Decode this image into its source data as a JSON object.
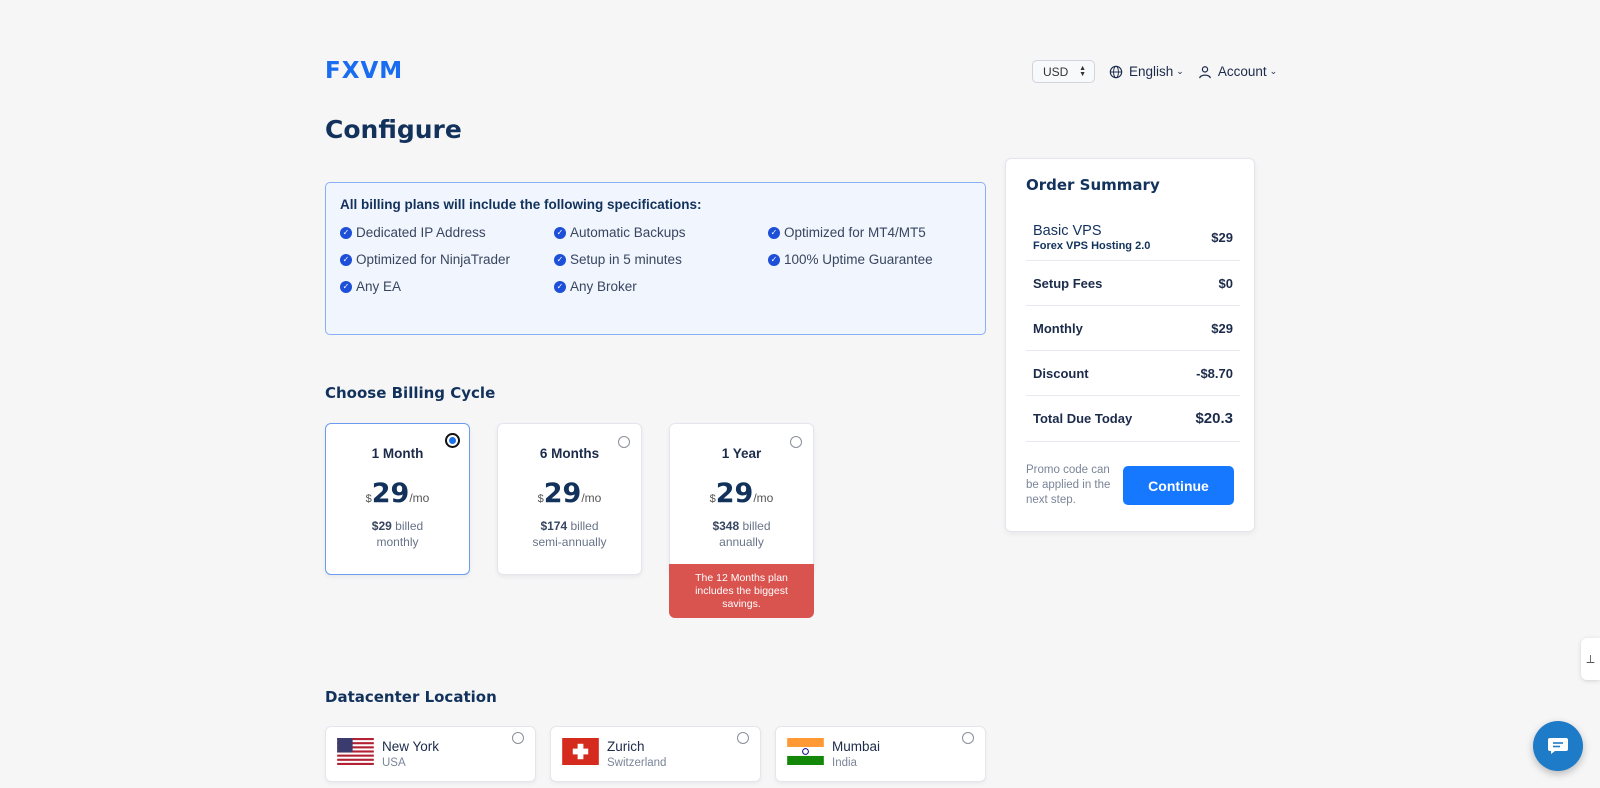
{
  "brand": {
    "logo_text": "FXVM"
  },
  "topnav": {
    "currency": "USD",
    "language": "English",
    "account": "Account"
  },
  "page": {
    "title": "Configure"
  },
  "specs": {
    "heading": "All billing plans will include the following specifications:",
    "items": [
      "Dedicated IP Address",
      "Automatic Backups",
      "Optimized for MT4/MT5",
      "Optimized for NinjaTrader",
      "Setup in 5 minutes",
      "100% Uptime Guarantee",
      "Any EA",
      "Any Broker"
    ]
  },
  "billing": {
    "heading": "Choose Billing Cycle",
    "options": [
      {
        "name": "1 Month",
        "currency": "$",
        "price": "29",
        "per": "/mo",
        "billed_amount": "$29",
        "billed_word": "billed",
        "billed_period": "monthly",
        "selected": true
      },
      {
        "name": "6 Months",
        "currency": "$",
        "price": "29",
        "per": "/mo",
        "billed_amount": "$174",
        "billed_word": "billed",
        "billed_period": "semi-annually",
        "selected": false
      },
      {
        "name": "1 Year",
        "currency": "$",
        "price": "29",
        "per": "/mo",
        "billed_amount": "$348",
        "billed_word": "billed",
        "billed_period": "annually",
        "selected": false,
        "note": "The 12 Months plan includes the biggest savings."
      }
    ]
  },
  "datacenter": {
    "heading": "Datacenter Location",
    "locations": [
      {
        "city": "New York",
        "country": "USA",
        "flag": "us-flag"
      },
      {
        "city": "Zurich",
        "country": "Switzerland",
        "flag": "swiss-flag"
      },
      {
        "city": "Mumbai",
        "country": "India",
        "flag": "india-flag"
      }
    ]
  },
  "summary": {
    "heading": "Order Summary",
    "plan_name": "Basic VPS",
    "plan_sub": "Forex VPS Hosting 2.0",
    "plan_price": "$29",
    "rows": [
      {
        "label": "Setup Fees",
        "value": "$0"
      },
      {
        "label": "Monthly",
        "value": "$29"
      },
      {
        "label": "Discount",
        "value": "-$8.70"
      }
    ],
    "total_label": "Total Due Today",
    "total_value": "$20.3",
    "promo_note": "Promo code can be applied in the next step.",
    "continue_label": "Continue"
  },
  "colors": {
    "accent": "#1677ff",
    "heading": "#12325c",
    "savings_banner": "#d9534f",
    "chat_button": "#1e7bc8"
  }
}
